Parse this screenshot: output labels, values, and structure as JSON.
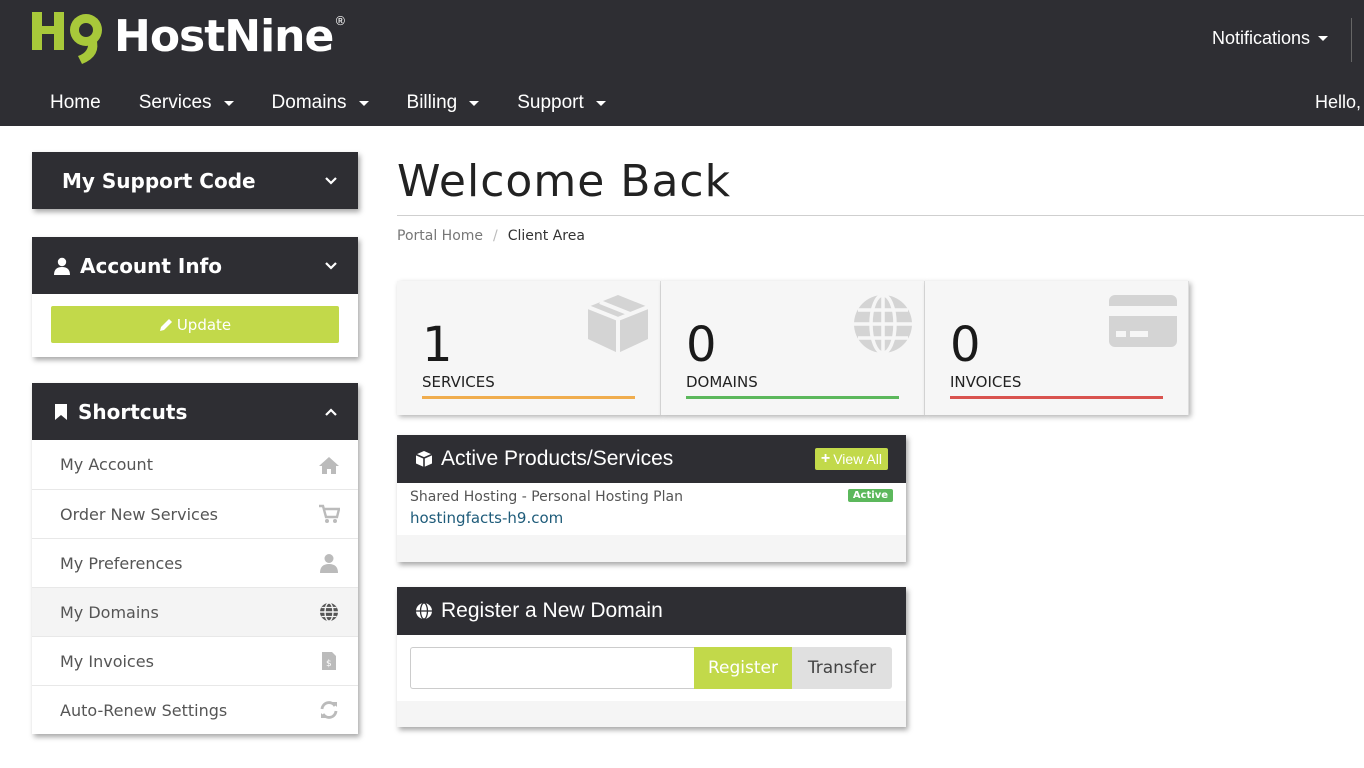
{
  "brand": {
    "name": "HostNine",
    "registered": "®",
    "mark": "H9"
  },
  "header": {
    "notifications_label": "Notifications",
    "greeting": "Hello,",
    "nav": [
      {
        "label": "Home",
        "dropdown": false
      },
      {
        "label": "Services",
        "dropdown": true
      },
      {
        "label": "Domains",
        "dropdown": true
      },
      {
        "label": "Billing",
        "dropdown": true
      },
      {
        "label": "Support",
        "dropdown": true
      }
    ]
  },
  "sidebar": {
    "support_code": {
      "title": "My Support Code"
    },
    "account_info": {
      "title": "Account Info",
      "update_label": "Update"
    },
    "shortcuts": {
      "title": "Shortcuts",
      "items": [
        {
          "label": "My Account",
          "icon": "home-icon"
        },
        {
          "label": "Order New Services",
          "icon": "cart-icon"
        },
        {
          "label": "My Preferences",
          "icon": "user-icon"
        },
        {
          "label": "My Domains",
          "icon": "globe-icon"
        },
        {
          "label": "My Invoices",
          "icon": "invoice-icon"
        },
        {
          "label": "Auto-Renew Settings",
          "icon": "refresh-icon"
        }
      ]
    }
  },
  "main": {
    "title": "Welcome Back",
    "breadcrumb": {
      "home": "Portal Home",
      "separator": "/",
      "current": "Client Area"
    },
    "tiles": [
      {
        "count": "1",
        "label": "SERVICES",
        "color": "#f0ad4e",
        "icon": "cube-icon"
      },
      {
        "count": "0",
        "label": "DOMAINS",
        "color": "#5cb85c",
        "icon": "globe-icon"
      },
      {
        "count": "0",
        "label": "INVOICES",
        "color": "#d9534f",
        "icon": "credit-card-icon"
      }
    ],
    "active_products": {
      "title": "Active Products/Services",
      "view_all_label": "View All",
      "items": [
        {
          "name": "Shared Hosting - Personal Hosting Plan",
          "domain": "hostingfacts-h9.com",
          "status": "Active"
        }
      ]
    },
    "register_domain": {
      "title": "Register a New Domain",
      "input_value": "",
      "register_label": "Register",
      "transfer_label": "Transfer"
    }
  },
  "colors": {
    "header_bg": "#2e2e33",
    "accent": "#c2d94a",
    "link": "#1f5c7a",
    "active_badge": "#5cb85c"
  }
}
